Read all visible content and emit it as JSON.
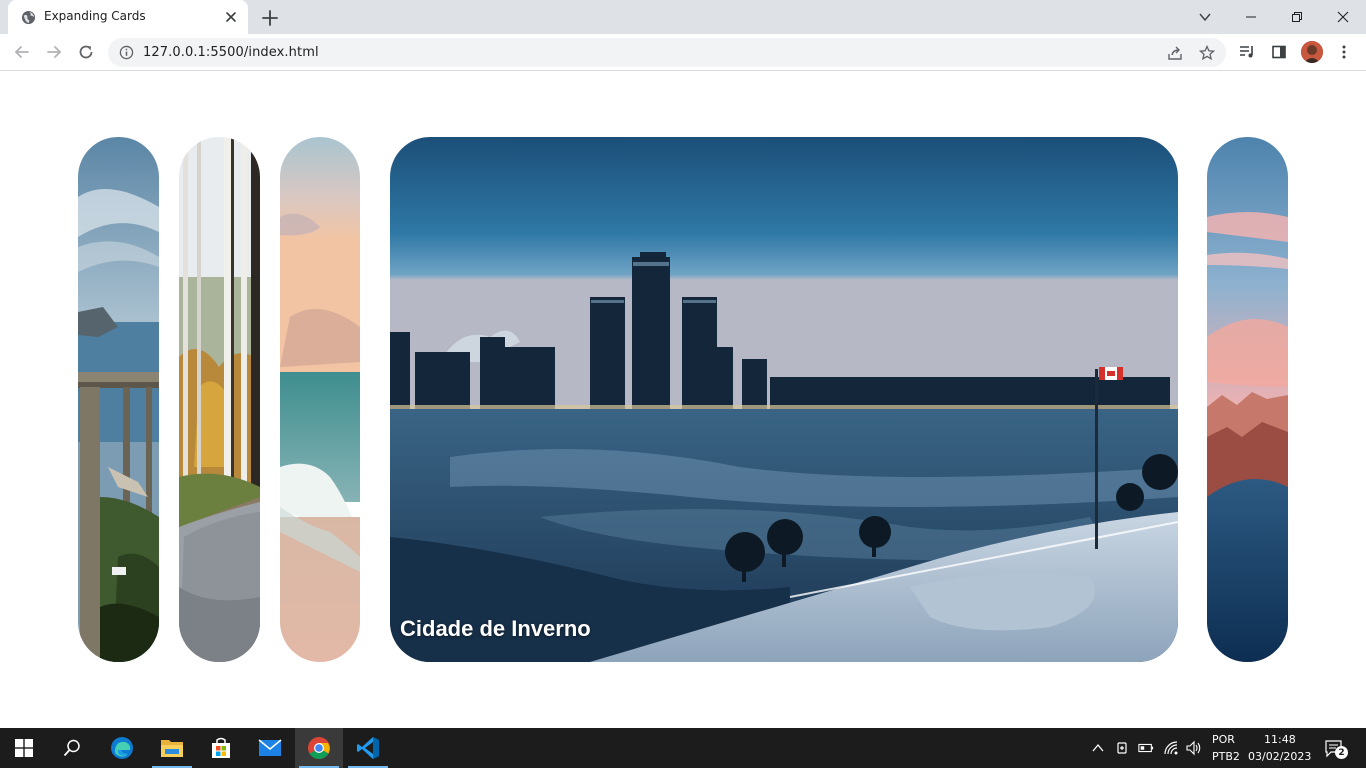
{
  "browser": {
    "tab": {
      "title": "Expanding Cards",
      "favicon": "globe-icon",
      "close_icon": "close-icon"
    },
    "new_tab_icon": "plus-icon",
    "window_controls": [
      "chevron-down-icon",
      "minimize-icon",
      "restore-icon",
      "close-icon"
    ],
    "toolbar": {
      "back_icon": "arrow-left-icon",
      "forward_icon": "arrow-right-icon",
      "reload_icon": "reload-icon",
      "site_info_icon": "info-icon",
      "url": "127.0.0.1:5500/index.html",
      "share_icon": "share-icon",
      "bookmark_icon": "star-icon",
      "media_icon": "media-queue-icon",
      "side_panel_icon": "side-panel-icon",
      "profile": "avatar",
      "menu_icon": "kebab-menu-icon"
    }
  },
  "page": {
    "cards": [
      {
        "id": "coast-bridge",
        "active": false,
        "caption": ""
      },
      {
        "id": "birch-forest-path",
        "active": false,
        "caption": ""
      },
      {
        "id": "beach-sunset",
        "active": false,
        "caption": ""
      },
      {
        "id": "winter-city",
        "active": true,
        "caption": "Cidade de Inverno"
      },
      {
        "id": "pink-mountains",
        "active": false,
        "caption": ""
      }
    ]
  },
  "taskbar": {
    "apps": [
      {
        "name": "start",
        "icon": "windows-logo-icon"
      },
      {
        "name": "search",
        "icon": "search-icon"
      },
      {
        "name": "edge",
        "icon": "edge-icon"
      },
      {
        "name": "file-explorer",
        "icon": "folder-icon"
      },
      {
        "name": "store",
        "icon": "store-icon"
      },
      {
        "name": "mail",
        "icon": "mail-icon"
      },
      {
        "name": "chrome",
        "icon": "chrome-icon",
        "active": true
      },
      {
        "name": "vscode",
        "icon": "vscode-icon",
        "active": true
      }
    ],
    "tray": {
      "language_line1": "POR",
      "language_line2": "PTB2",
      "time": "11:48",
      "date": "03/02/2023",
      "notifications_count": "2"
    }
  }
}
